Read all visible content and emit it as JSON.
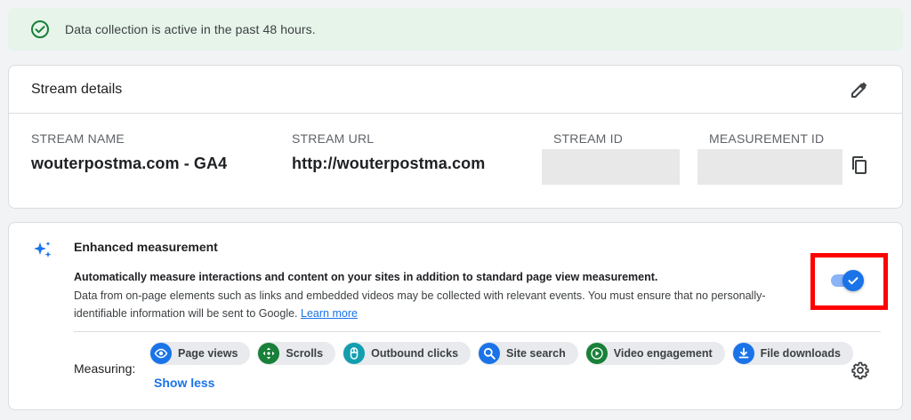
{
  "banner": {
    "text": "Data collection is active in the past 48 hours."
  },
  "stream": {
    "title": "Stream details",
    "name_label": "STREAM NAME",
    "name_value": "wouterpostma.com - GA4",
    "url_label": "STREAM URL",
    "url_value": "http://wouterpostma.com",
    "id_label": "STREAM ID",
    "measurement_label": "MEASUREMENT ID"
  },
  "enhanced": {
    "title": "Enhanced measurement",
    "desc1": "Automatically measure interactions and content on your sites in addition to standard page view measurement.",
    "desc2": "Data from on-page elements such as links and embedded videos may be collected with relevant events. You must ensure that no personally-identifiable information will be sent to Google.",
    "learn_more": "Learn more",
    "toggle_on": true,
    "measuring_label": "Measuring:",
    "chips": [
      {
        "label": "Page views",
        "icon": "eye-icon",
        "color": "#1a73e8"
      },
      {
        "label": "Scrolls",
        "icon": "move-icon",
        "color": "#188038"
      },
      {
        "label": "Outbound clicks",
        "icon": "mouse-icon",
        "color": "#129eaf"
      },
      {
        "label": "Site search",
        "icon": "search-icon",
        "color": "#1a73e8"
      },
      {
        "label": "Video engagement",
        "icon": "play-icon",
        "color": "#188038"
      },
      {
        "label": "File downloads",
        "icon": "download-icon",
        "color": "#1a73e8"
      }
    ],
    "show_less": "Show less"
  },
  "colors": {
    "accent": "#1a73e8",
    "success": "#188038",
    "banner_bg": "#e6f4ea",
    "highlight": "#ff0000"
  }
}
